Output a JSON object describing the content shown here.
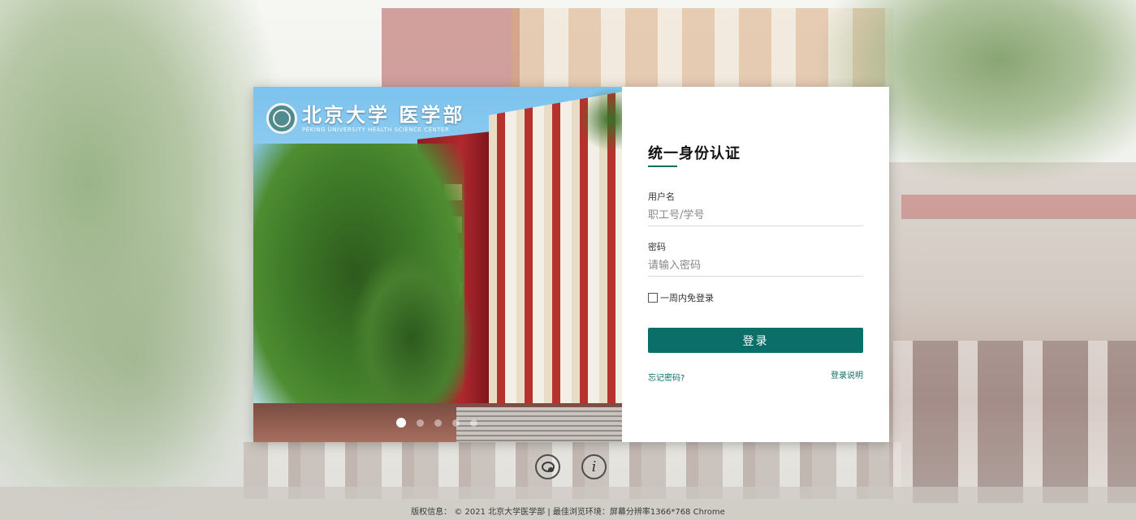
{
  "logo": {
    "title": "北京大学 医学部",
    "subtitle": "PEKING UNIVERSITY HEALTH SCIENCE CENTER"
  },
  "carousel": {
    "slide_count": 5,
    "active_index": 0
  },
  "form": {
    "title": "统一身份认证",
    "username_label": "用户名",
    "username_placeholder": "职工号/学号",
    "username_value": "",
    "password_label": "密码",
    "password_placeholder": "请输入密码",
    "password_value": "",
    "remember_label": "一周内免登录",
    "remember_checked": false,
    "login_label": "登录",
    "forgot_label": "忘记密码?",
    "help_label": "登录说明"
  },
  "footer": {
    "text": "版权信息：  © 2021 北京大学医学部 | 最佳浏览环境：屏幕分辨率1366*768 Chrome"
  },
  "icons": [
    "chat-icon",
    "info-icon",
    "shield-emblem-icon"
  ],
  "colors": {
    "accent": "#0b6e69",
    "card_bg": "#ffffff"
  }
}
